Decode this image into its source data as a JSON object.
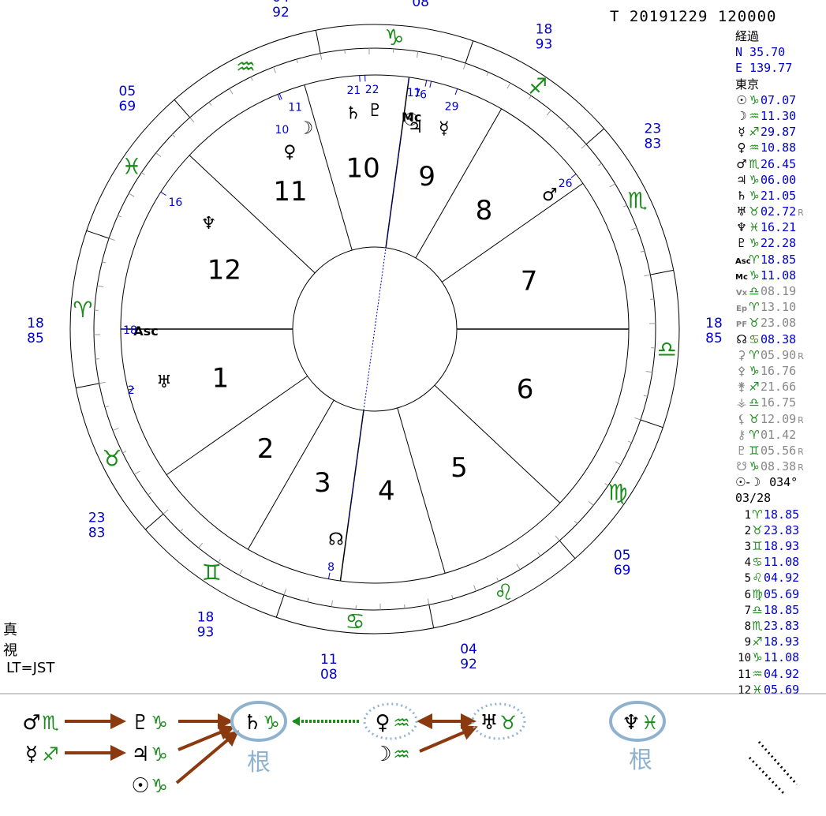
{
  "header": {
    "title": "T  20191229 120000"
  },
  "location": {
    "mode": "経過",
    "lat": "N  35.70",
    "lon": "E 139.77",
    "place": "東京"
  },
  "planets": [
    {
      "glyph": "☉",
      "sign": "♑",
      "value": "07.07",
      "retro": ""
    },
    {
      "glyph": "☽",
      "sign": "♒",
      "value": "11.30",
      "retro": ""
    },
    {
      "glyph": "☿",
      "sign": "♐",
      "value": "29.87",
      "retro": ""
    },
    {
      "glyph": "♀",
      "sign": "♒",
      "value": "10.88",
      "retro": ""
    },
    {
      "glyph": "♂",
      "sign": "♏",
      "value": "26.45",
      "retro": ""
    },
    {
      "glyph": "♃",
      "sign": "♑",
      "value": "06.00",
      "retro": ""
    },
    {
      "glyph": "♄",
      "sign": "♑",
      "value": "21.05",
      "retro": ""
    },
    {
      "glyph": "♅",
      "sign": "♉",
      "value": "02.72",
      "retro": "R"
    },
    {
      "glyph": "♆",
      "sign": "♓",
      "value": "16.21",
      "retro": ""
    },
    {
      "glyph": "♇",
      "sign": "♑",
      "value": "22.28",
      "retro": ""
    },
    {
      "glyph": "Asc",
      "sign": "♈",
      "value": "18.85",
      "retro": ""
    },
    {
      "glyph": "Mc",
      "sign": "♑",
      "value": "11.08",
      "retro": ""
    }
  ],
  "points": [
    {
      "glyph": "Vx",
      "sign": "♎",
      "value": "08.19",
      "retro": ""
    },
    {
      "glyph": "Ep",
      "sign": "♈",
      "value": "13.10",
      "retro": ""
    },
    {
      "glyph": "PF",
      "sign": "♉",
      "value": "23.08",
      "retro": ""
    },
    {
      "glyph": "☊",
      "sign": "♋",
      "value": "08.38",
      "retro": "",
      "black": true
    },
    {
      "glyph": "⚳",
      "sign": "♈",
      "value": "05.90",
      "retro": "R"
    },
    {
      "glyph": "⚴",
      "sign": "♑",
      "value": "16.76",
      "retro": ""
    },
    {
      "glyph": "⚵",
      "sign": "♐",
      "value": "21.66",
      "retro": ""
    },
    {
      "glyph": "⚶",
      "sign": "♎",
      "value": "16.75",
      "retro": ""
    },
    {
      "glyph": "⚸",
      "sign": "♉",
      "value": "12.09",
      "retro": "R"
    },
    {
      "glyph": "⚷",
      "sign": "♈",
      "value": "01.42",
      "retro": ""
    },
    {
      "glyph": "♇",
      "sign": "♊",
      "value": "05.56",
      "retro": "R"
    },
    {
      "glyph": "☋",
      "sign": "♑",
      "value": "08.38",
      "retro": "R"
    }
  ],
  "phase": {
    "label": "☉-☽",
    "angle": "034°",
    "day": "03/28"
  },
  "houses": [
    {
      "n": "1",
      "sign": "♈",
      "value": "18.85"
    },
    {
      "n": "2",
      "sign": "♉",
      "value": "23.83"
    },
    {
      "n": "3",
      "sign": "♊",
      "value": "18.93"
    },
    {
      "n": "4",
      "sign": "♋",
      "value": "11.08"
    },
    {
      "n": "5",
      "sign": "♌",
      "value": "04.92"
    },
    {
      "n": "6",
      "sign": "♍",
      "value": "05.69"
    },
    {
      "n": "7",
      "sign": "♎",
      "value": "18.85"
    },
    {
      "n": "8",
      "sign": "♏",
      "value": "23.83"
    },
    {
      "n": "9",
      "sign": "♐",
      "value": "18.93"
    },
    {
      "n": "10",
      "sign": "♑",
      "value": "11.08"
    },
    {
      "n": "11",
      "sign": "♒",
      "value": "04.92"
    },
    {
      "n": "12",
      "sign": "♓",
      "value": "05.69"
    }
  ],
  "footer": {
    "line1": "真",
    "line2": "視",
    "line3": "LT=JST"
  },
  "chart": {
    "cusp_labels": [
      {
        "top": "18",
        "bottom": "85"
      },
      {
        "top": "23",
        "bottom": "83"
      },
      {
        "top": "18",
        "bottom": "93"
      },
      {
        "top": "11",
        "bottom": "08"
      },
      {
        "top": "04",
        "bottom": "92"
      },
      {
        "top": "05",
        "bottom": "69"
      },
      {
        "top": "18",
        "bottom": "85"
      },
      {
        "top": "23",
        "bottom": "83"
      },
      {
        "top": "18",
        "bottom": "93"
      },
      {
        "top": "11",
        "bottom": "08"
      },
      {
        "top": "04",
        "bottom": "92"
      },
      {
        "top": "05",
        "bottom": "69"
      }
    ],
    "house_numbers": [
      "1",
      "2",
      "3",
      "4",
      "5",
      "6",
      "7",
      "8",
      "9",
      "10",
      "11",
      "12"
    ],
    "signs": [
      "♈",
      "♉",
      "♊",
      "♋",
      "♌",
      "♍",
      "♎",
      "♏",
      "♐",
      "♑",
      "♒",
      "♓"
    ],
    "planet_marks": [
      {
        "glyph": "Asc",
        "deg": "18"
      },
      {
        "glyph": "♅",
        "deg": "2"
      },
      {
        "glyph": "♆",
        "deg": "16"
      },
      {
        "glyph": "☽",
        "deg": "11"
      },
      {
        "glyph": "♀",
        "deg": "10"
      },
      {
        "glyph": "♇",
        "deg": "22"
      },
      {
        "glyph": "♄",
        "deg": "21"
      },
      {
        "glyph": "Mc",
        "deg": "11"
      },
      {
        "glyph": "☉",
        "deg": "7"
      },
      {
        "glyph": "♃",
        "deg": "6"
      },
      {
        "glyph": "☿",
        "deg": "29"
      },
      {
        "glyph": "♂",
        "deg": "26"
      },
      {
        "glyph": "☊",
        "deg": "8"
      }
    ]
  },
  "dispositor": {
    "nodes": [
      {
        "id": "mars",
        "glyph": "♂",
        "sign": "♏"
      },
      {
        "id": "merc",
        "glyph": "☿",
        "sign": "♐"
      },
      {
        "id": "pluto",
        "glyph": "♇",
        "sign": "♑"
      },
      {
        "id": "jup",
        "glyph": "♃",
        "sign": "♑"
      },
      {
        "id": "sun",
        "glyph": "☉",
        "sign": "♑"
      },
      {
        "id": "sat",
        "glyph": "♄",
        "sign": "♑"
      },
      {
        "id": "venus",
        "glyph": "♀",
        "sign": "♒"
      },
      {
        "id": "moon",
        "glyph": "☽",
        "sign": "♒"
      },
      {
        "id": "uranus",
        "glyph": "♅",
        "sign": "♉"
      },
      {
        "id": "nep",
        "glyph": "♆",
        "sign": "♓"
      }
    ],
    "root_label_1": "根",
    "root_label_2": "根"
  },
  "colors": {
    "blue": "#0000cc",
    "green": "#1a8c1a",
    "arrow": "#8b3a0f",
    "ring": "#8fb3cf"
  }
}
